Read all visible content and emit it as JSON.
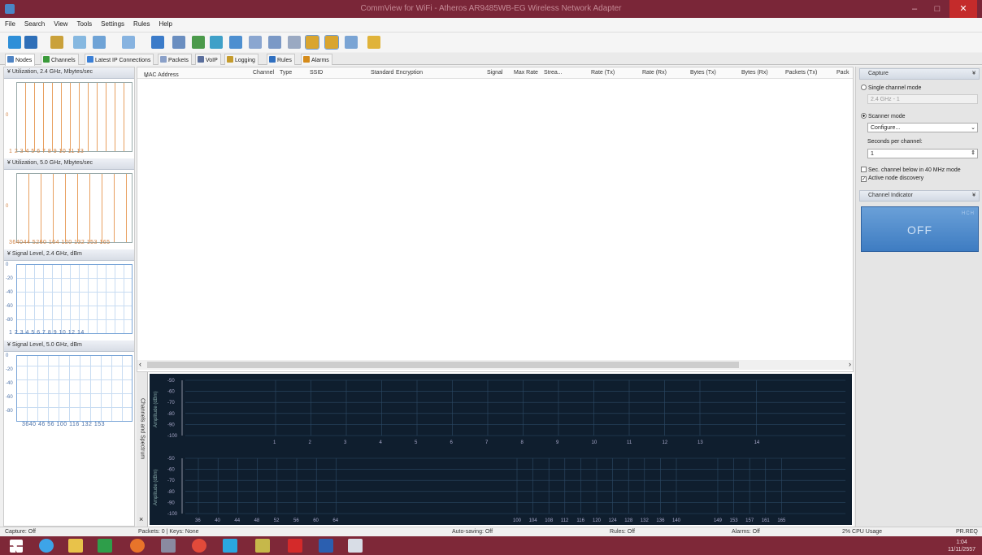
{
  "window": {
    "title": "CommView for WiFi - Atheros AR9485WB-EG Wireless Network Adapter",
    "minimize": "–",
    "maximize": "□",
    "close": "✕"
  },
  "menu": [
    "File",
    "Search",
    "View",
    "Tools",
    "Settings",
    "Rules",
    "Help"
  ],
  "toolbar_icons": [
    "start-capture-icon",
    "stop-capture-icon",
    "open-log-icon",
    "packet-generator-icon",
    "reconstruct-icon",
    "save-icon",
    "search-icon",
    "decrypt-icon",
    "nodes-icon",
    "statistics-icon",
    "settings-icon",
    "log-viewer-icon",
    "monitor-icon",
    "tools-icon",
    "rule-icon",
    "alarm-icon",
    "pin-icon",
    "about-icon"
  ],
  "tabs": [
    {
      "label": "Nodes",
      "icon": "nodes-icon",
      "color": "#4f84c4"
    },
    {
      "label": "Channels",
      "icon": "channels-icon",
      "color": "#3a9a3a"
    },
    {
      "label": "Latest IP Connections",
      "icon": "connections-icon",
      "color": "#3a7fd6"
    },
    {
      "label": "Packets",
      "icon": "packets-icon",
      "color": "#8aa0c8"
    },
    {
      "label": "VoIP",
      "icon": "voip-icon",
      "color": "#5a6e9c"
    },
    {
      "label": "Logging",
      "icon": "logging-icon",
      "color": "#c59b2c"
    },
    {
      "label": "Rules",
      "icon": "rules-icon",
      "color": "#2f6fc0"
    },
    {
      "label": "Alarms",
      "icon": "alarms-icon",
      "color": "#d58b1a"
    }
  ],
  "left": {
    "g1": {
      "title": "Utilization, 2.4 GHz, Mbytes/sec",
      "ticks": "1 2 3 4 5 6 7 8 9 10 11  13",
      "y": "0"
    },
    "g2": {
      "title": "Utilization, 5.0 GHz, Mbytes/sec",
      "ticks": "364044  5260 104  120 132  153 165",
      "y": "0"
    },
    "g3": {
      "title": "Signal Level, 2.4 GHz, dBm",
      "ticks": "1 2 3 4 5 6 7 8 9 10  12  14",
      "y": [
        "0",
        "-20",
        "-40",
        "-60",
        "-80"
      ]
    },
    "g4": {
      "title": "Signal Level, 5.0 GHz, dBm",
      "ticks": "3640  46  56 100  116  132  153",
      "y": [
        "0",
        "-20",
        "-40",
        "-60",
        "-80"
      ]
    }
  },
  "grid": {
    "columns": [
      "MAC Address",
      "Channel",
      "Type",
      "SSID",
      "Standard",
      "Encryption",
      "Signal",
      "Max Rate",
      "Strea...",
      "Rate (Tx)",
      "Rate (Rx)",
      "Bytes (Tx)",
      "Bytes (Rx)",
      "Packets (Tx)",
      "Pack"
    ],
    "sort_marker": "⌄",
    "scroll_left": "‹",
    "scroll_right": "›"
  },
  "spectrum": {
    "tab_label": "Channels and Spectrum",
    "close": "×",
    "ylabel": "Amplitude (dBm)",
    "top_y": [
      "-50",
      "-60",
      "-70",
      "-80",
      "-90",
      "-100"
    ],
    "top_channels": [
      "1",
      "2",
      "3",
      "4",
      "5",
      "6",
      "7",
      "8",
      "9",
      "10",
      "11",
      "12",
      "13",
      "14"
    ],
    "bottom_y": [
      "-50",
      "-60",
      "-70",
      "-80",
      "-90",
      "-100"
    ],
    "bottom_channels_low": [
      "36",
      "40",
      "44",
      "48",
      "52",
      "56",
      "60",
      "64"
    ],
    "bottom_channels_high": [
      "100",
      "104",
      "108",
      "112",
      "116",
      "120",
      "124",
      "128",
      "132",
      "136",
      "140",
      "149",
      "153",
      "157",
      "161",
      "165"
    ]
  },
  "right": {
    "capture_header": "Capture",
    "single_mode": "Single channel mode",
    "single_value": "2.4 GHz - 1",
    "scanner_mode": "Scanner mode",
    "configure": "Configure...",
    "seconds_label": "Seconds per channel:",
    "seconds_value": "1",
    "sec_channel": "Sec. channel below in 40 MHz mode",
    "active_discovery": "Active node discovery",
    "indicator_header": "Channel Indicator",
    "off_label": "OFF",
    "off_badge": "HCH"
  },
  "status": {
    "capture": "Capture: Off",
    "packets": "Packets: 0 | Keys: None",
    "autosave": "Auto-saving: Off",
    "rules": "Rules: Off",
    "alarms": "Alarms: Off",
    "cpu": "2% CPU Usage",
    "prreq": "PR.REQ"
  },
  "taskbar": {
    "time": "1:04",
    "date": "11/11/2557",
    "apps": [
      "start-icon",
      "internet-explorer-icon",
      "file-explorer-icon",
      "store-icon",
      "firefox-icon",
      "app-icon",
      "chrome-icon",
      "skype-icon",
      "photos-icon",
      "acrobat-icon",
      "word-icon",
      "commview-icon"
    ]
  }
}
